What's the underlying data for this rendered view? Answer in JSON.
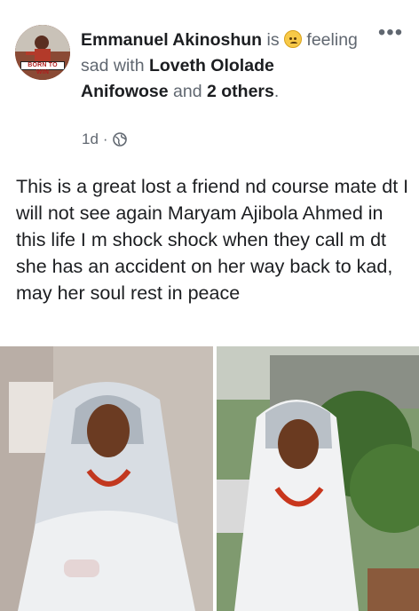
{
  "post": {
    "author": "Emmanuel Akinoshun",
    "is_text": "is",
    "feeling_text": "feeling sad with",
    "tagged_friend": "Loveth Ololade Anifowose",
    "and_text": "and",
    "others_text": "2 others",
    "period": ".",
    "time": "1d",
    "separator": "·",
    "privacy_icon": "globe-icon",
    "feeling_icon": "sad-face-emoji",
    "more_icon": "more-options-icon",
    "avatar_text": "BORN TO WIN",
    "body": "This is a great lost a friend nd course mate dt I will not see again Maryam Ajibola Ahmed in this life I m shock shock when they call m dt she has an accident on her way back to kad, may her soul rest in peace"
  },
  "colors": {
    "text_primary": "#1c1e21",
    "text_secondary": "#606770",
    "background": "#ffffff"
  }
}
